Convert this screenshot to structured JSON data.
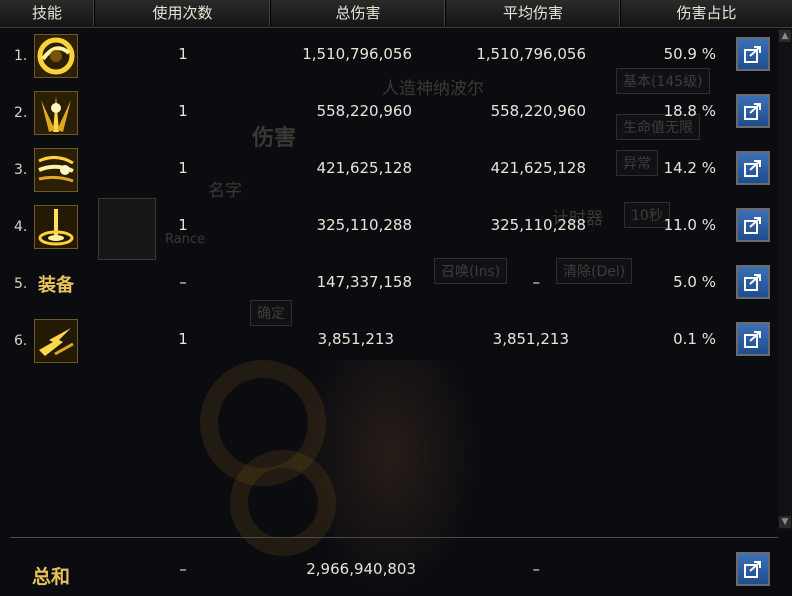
{
  "header": {
    "skill": "技能",
    "uses": "使用次数",
    "total_damage": "总伤害",
    "avg_damage": "平均伤害",
    "share": "伤害占比"
  },
  "rows": [
    {
      "rank": "1.",
      "icon": "crescent-slash-skill-icon",
      "equip_label": "",
      "uses": "1",
      "total": "1,510,796,056",
      "avg": "1,510,796,056",
      "pct": "50.9 %"
    },
    {
      "rank": "2.",
      "icon": "radiant-burst-skill-icon",
      "equip_label": "",
      "uses": "1",
      "total": "558,220,960",
      "avg": "558,220,960",
      "pct": "18.8 %"
    },
    {
      "rank": "3.",
      "icon": "wave-beam-skill-icon",
      "equip_label": "",
      "uses": "1",
      "total": "421,625,128",
      "avg": "421,625,128",
      "pct": "14.2 %"
    },
    {
      "rank": "4.",
      "icon": "ground-strike-skill-icon",
      "equip_label": "",
      "uses": "1",
      "total": "325,110,288",
      "avg": "325,110,288",
      "pct": "11.0 %"
    },
    {
      "rank": "5.",
      "icon": "",
      "equip_label": "装备",
      "uses": "–",
      "total": "147,337,158",
      "avg": "–",
      "pct": "5.0 %"
    },
    {
      "rank": "6.",
      "icon": "lightning-dash-skill-icon",
      "equip_label": "",
      "uses": "1",
      "total": "3,851,213",
      "avg": "3,851,213",
      "pct": "0.1 %"
    }
  ],
  "summary": {
    "label": "总和",
    "uses": "–",
    "total": "2,966,940,803",
    "avg": "–"
  },
  "background_ghost_text": {
    "monster": "人造神纳波尔",
    "damage_tab": "伤害",
    "basic": "基本(145级)",
    "life": "生命值无限",
    "unusual": "异常",
    "name": "名字",
    "rance": "Rance",
    "timer": "计时器",
    "seconds": "10秒",
    "summon": "召唤(Ins)",
    "clear": "清除(Del)",
    "confirm": "确定"
  },
  "colors": {
    "gold": "#e6c25a",
    "button_blue": "#2a5ea8",
    "header_bg": "#222222"
  }
}
